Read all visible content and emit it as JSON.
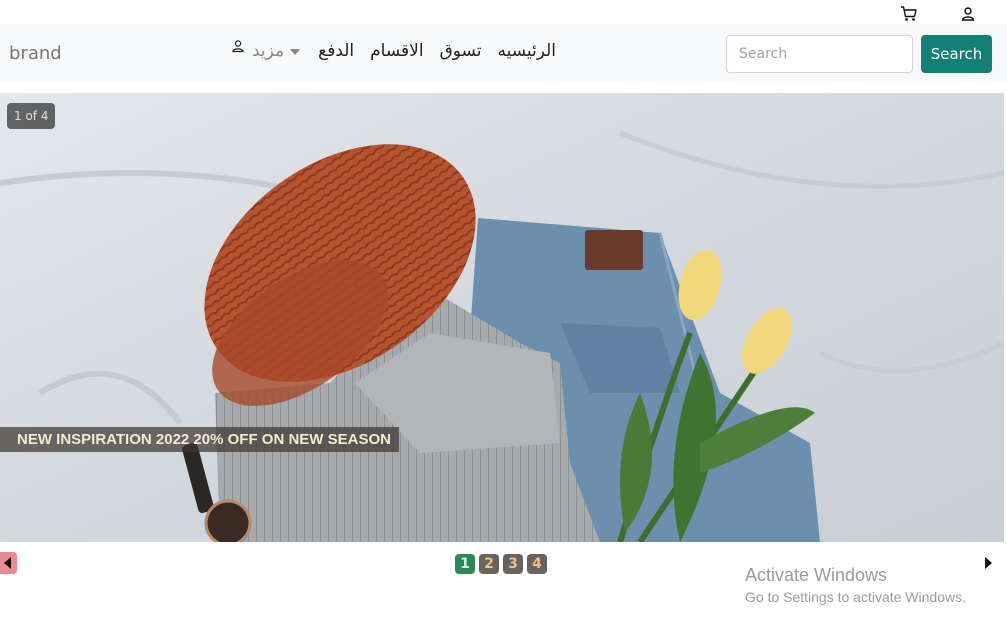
{
  "topbar": {
    "icons": [
      "cart-icon",
      "user-icon"
    ]
  },
  "navbar": {
    "brand": "brand",
    "links": [
      {
        "label": "الرئيسيه"
      },
      {
        "label": "تسوق"
      },
      {
        "label": "الاقسام"
      },
      {
        "label": "الدفع"
      }
    ],
    "more_label": "مزيد",
    "search": {
      "placeholder": "Search",
      "button_label": "Search"
    }
  },
  "carousel": {
    "counter": "1 of 4",
    "caption": "NEW INSPIRATION 2022 20% OFF ON NEW SEASON",
    "pages": [
      "1",
      "2",
      "3",
      "4"
    ],
    "active_page": 1
  },
  "watermark": {
    "title": "Activate Windows",
    "subtitle": "Go to Settings to activate Windows."
  },
  "colors": {
    "accent": "#138077",
    "active_page": "#2b8a57",
    "page_inactive": "#666360",
    "prev_button": "#e98b90"
  }
}
